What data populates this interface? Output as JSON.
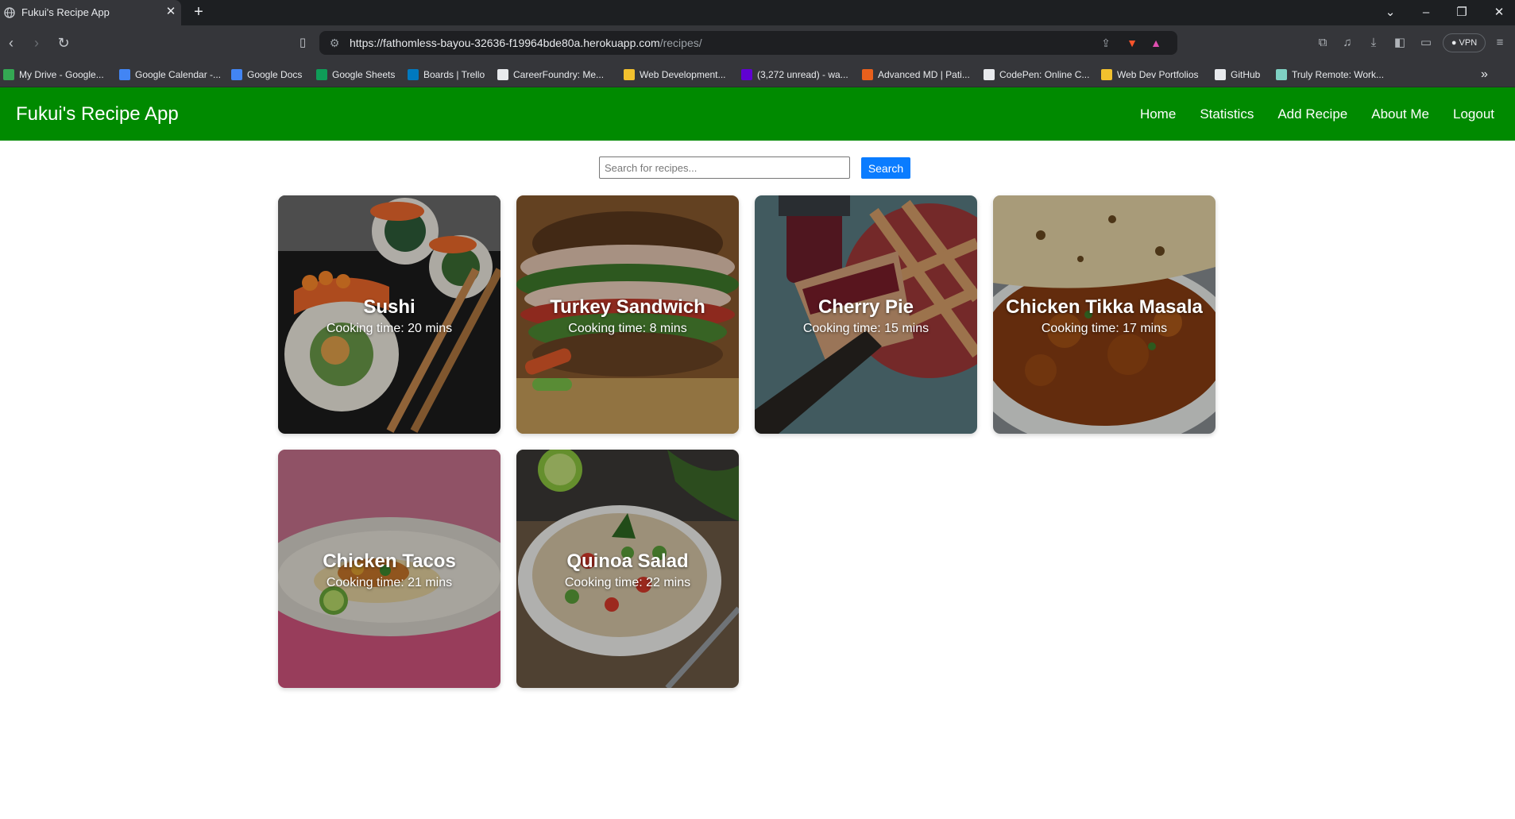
{
  "browser": {
    "tab_title": "Fukui's Recipe App",
    "url_host": "https://fathomless-bayou-32636-f19964bde80a.herokuapp.com",
    "url_path": "/recipes/",
    "vpn_label": "VPN",
    "bookmarks": [
      {
        "label": "My Drive - Google...",
        "icon": "google-drive-icon",
        "color": "#34a853"
      },
      {
        "label": "Google Calendar -...",
        "icon": "google-calendar-icon",
        "color": "#4285f4"
      },
      {
        "label": "Google Docs",
        "icon": "google-docs-icon",
        "color": "#4285f4"
      },
      {
        "label": "Google Sheets",
        "icon": "google-sheets-icon",
        "color": "#0f9d58"
      },
      {
        "label": "Boards | Trello",
        "icon": "trello-icon",
        "color": "#0079bf"
      },
      {
        "label": "CareerFoundry: Me...",
        "icon": "careerfoundry-icon",
        "color": "#e8eaed"
      },
      {
        "label": "Web Development...",
        "icon": "folder-icon",
        "color": "#f2c12e"
      },
      {
        "label": "(3,272 unread) - wa...",
        "icon": "yahoo-mail-icon",
        "color": "#6001d2"
      },
      {
        "label": "Advanced MD | Pati...",
        "icon": "advancedmd-icon",
        "color": "#e8601c"
      },
      {
        "label": "CodePen: Online C...",
        "icon": "codepen-icon",
        "color": "#e8eaed"
      },
      {
        "label": "Web Dev Portfolios",
        "icon": "folder-icon",
        "color": "#f2c12e"
      },
      {
        "label": "GitHub",
        "icon": "github-icon",
        "color": "#e8eaed"
      },
      {
        "label": "Truly Remote: Work...",
        "icon": "truly-remote-icon",
        "color": "#7fd1c3"
      }
    ]
  },
  "app": {
    "brand": "Fukui's Recipe App",
    "accent": "#008a00",
    "nav": [
      "Home",
      "Statistics",
      "Add Recipe",
      "About Me",
      "Logout"
    ]
  },
  "search": {
    "placeholder": "Search for recipes...",
    "value": "",
    "button_label": "Search"
  },
  "recipes": [
    {
      "name": "Sushi",
      "time": "Cooking time: 20 mins",
      "image": "sushi-photo"
    },
    {
      "name": "Turkey Sandwich",
      "time": "Cooking time: 8 mins",
      "image": "turkey-sandwich-photo"
    },
    {
      "name": "Cherry Pie",
      "time": "Cooking time: 15 mins",
      "image": "cherry-pie-photo"
    },
    {
      "name": "Chicken Tikka Masala",
      "time": "Cooking time: 17 mins",
      "image": "chicken-tikka-masala-photo"
    },
    {
      "name": "Chicken Tacos",
      "time": "Cooking time: 21 mins",
      "image": "chicken-tacos-photo"
    },
    {
      "name": "Quinoa Salad",
      "time": "Cooking time: 22 mins",
      "image": "quinoa-salad-photo"
    }
  ]
}
